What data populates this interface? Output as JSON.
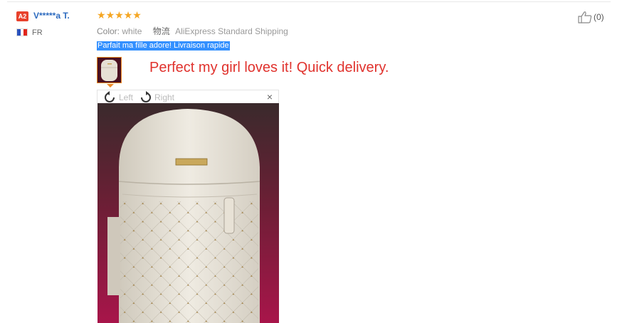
{
  "reviewer": {
    "badge": "A2",
    "name": "V*****a T.",
    "country": "FR",
    "flag_colors": [
      "#2a52be",
      "#ffffff",
      "#e1251b"
    ]
  },
  "rating": {
    "stars": 5,
    "star_glyph": "★"
  },
  "product": {
    "color_label": "Color:",
    "color_value": "white",
    "shipping_label": "物流",
    "shipping_value": "AliExpress Standard Shipping"
  },
  "review": {
    "original_text": "Parfait ma fille adore! Livraison rapide",
    "translation": "Perfect my girl loves it! Quick delivery."
  },
  "helpful": {
    "count": "(0)"
  },
  "viewer": {
    "rotate_left_label": "Left",
    "rotate_right_label": "Right",
    "close_glyph": "×"
  },
  "colors": {
    "username": "#2d6bbf",
    "badge": "#e8412c",
    "stars": "#f5a623",
    "highlight": "#3390ff",
    "translation": "#e0322d",
    "thumb_border": "#f08a24"
  }
}
